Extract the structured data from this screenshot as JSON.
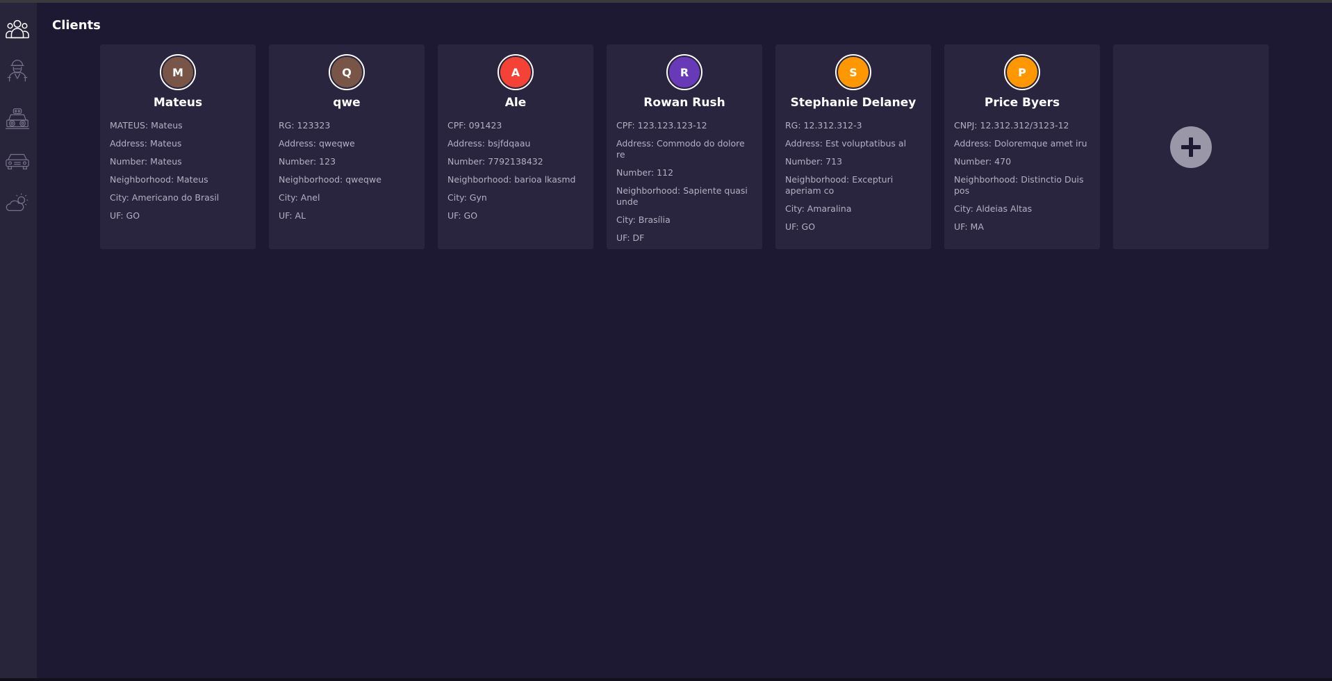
{
  "page": {
    "title": "Clients"
  },
  "sidebar": {
    "items": [
      {
        "name": "clients",
        "icon": "users-icon",
        "active": true
      },
      {
        "name": "employees",
        "icon": "worker-icon",
        "active": false
      },
      {
        "name": "services",
        "icon": "machine-icon",
        "active": false
      },
      {
        "name": "vehicles",
        "icon": "car-icon",
        "active": false
      },
      {
        "name": "weather",
        "icon": "cloud-sun-icon",
        "active": false
      }
    ]
  },
  "clients": [
    {
      "initial": "M",
      "color": "#795548",
      "name": "Mateus",
      "fields": [
        "MATEUS: Mateus",
        "Address: Mateus",
        "Number: Mateus",
        "Neighborhood: Mateus",
        "City: Americano do Brasil",
        "UF: GO"
      ]
    },
    {
      "initial": "Q",
      "color": "#795548",
      "name": "qwe",
      "fields": [
        "RG: 123323",
        "Address: qweqwe",
        "Number: 123",
        "Neighborhood: qweqwe",
        "City: Anel",
        "UF: AL"
      ]
    },
    {
      "initial": "A",
      "color": "#f44336",
      "name": "Ale",
      "fields": [
        "CPF: 091423",
        "Address: bsjfdqaau",
        "Number: 7792138432",
        "Neighborhood: barioa lkasmd",
        "City: Gyn",
        "UF: GO"
      ]
    },
    {
      "initial": "R",
      "color": "#673ab7",
      "name": "Rowan Rush",
      "fields": [
        "CPF: 123.123.123-12",
        "Address: Commodo do dolore re",
        "Number: 112",
        "Neighborhood: Sapiente quasi unde",
        "City: Brasília",
        "UF: DF"
      ]
    },
    {
      "initial": "S",
      "color": "#ff9800",
      "name": "Stephanie Delaney",
      "fields": [
        "RG: 12.312.312-3",
        "Address: Est voluptatibus al",
        "Number: 713",
        "Neighborhood: Excepturi aperiam co",
        "City: Amaralina",
        "UF: GO"
      ]
    },
    {
      "initial": "P",
      "color": "#ff9800",
      "name": "Price Byers",
      "fields": [
        "CNPJ: 12.312.312/3123-12",
        "Address: Doloremque amet iru",
        "Number: 470",
        "Neighborhood: Distinctio Duis pos",
        "City: Aldeias Altas",
        "UF: MA"
      ]
    }
  ],
  "add_card": {
    "icon": "plus-icon"
  },
  "colors": {
    "background": "#1e1932",
    "sidebar": "#28243a",
    "card": "#2a253e",
    "text_muted": "#b3b0c4",
    "add_button": "#9a97a8"
  }
}
